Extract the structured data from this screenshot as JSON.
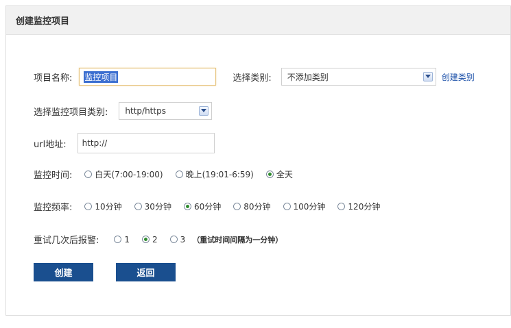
{
  "header": {
    "title": "创建监控项目"
  },
  "form": {
    "name_label": "项目名称:",
    "name_value": "监控项目",
    "category_label": "选择类别:",
    "category_value": "不添加类别",
    "create_category_link": "创建类别",
    "monitor_type_label": "选择监控项目类别:",
    "monitor_type_value": "http/https",
    "url_label": "url地址:",
    "url_value": "http://",
    "time_label": "监控时间:",
    "time_options": [
      "白天(7:00-19:00)",
      "晚上(19:01-6:59)",
      "全天"
    ],
    "time_selected": "全天",
    "freq_label": "监控频率:",
    "freq_options": [
      "10分钟",
      "30分钟",
      "60分钟",
      "80分钟",
      "100分钟",
      "120分钟"
    ],
    "freq_selected": "60分钟",
    "retry_label": "重试几次后报警:",
    "retry_options": [
      "1",
      "2",
      "3"
    ],
    "retry_selected": "2",
    "retry_hint": "（重试时间间隔为一分钟）"
  },
  "buttons": {
    "create": "创建",
    "back": "返回"
  },
  "colors": {
    "button_bg": "#1a4f8f",
    "link": "#1a4fa8",
    "radio_checked": "#2e8b2e"
  }
}
